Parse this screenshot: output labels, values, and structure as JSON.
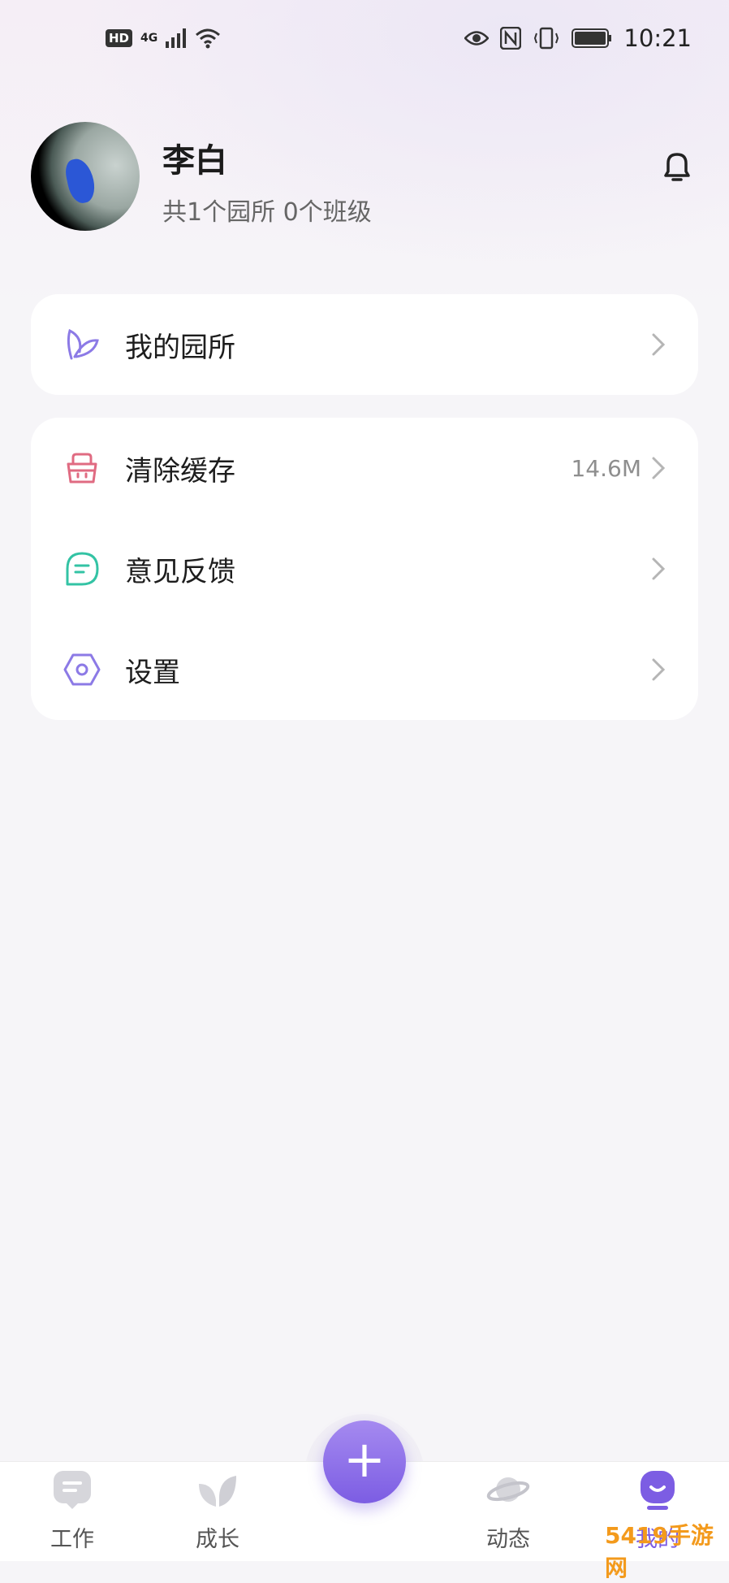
{
  "status_bar": {
    "hd": "HD",
    "signal": "4G",
    "time": "10:21"
  },
  "profile": {
    "name": "李白",
    "summary": "共1个园所 0个班级"
  },
  "menu": {
    "my_school": {
      "label": "我的园所"
    },
    "clear_cache": {
      "label": "清除缓存",
      "value": "14.6M"
    },
    "feedback": {
      "label": "意见反馈"
    },
    "settings": {
      "label": "设置"
    }
  },
  "tabs": [
    {
      "label": "工作",
      "icon": "work-icon"
    },
    {
      "label": "成长",
      "icon": "leaf-icon"
    },
    {
      "label": "动态",
      "icon": "planet-icon"
    },
    {
      "label": "我的",
      "icon": "profile-icon"
    }
  ],
  "fab": {
    "symbol": "+"
  },
  "colors": {
    "accent": "#7c5de3",
    "leaf": "#8c7ae6",
    "cache": "#e06b82",
    "feedback": "#33c3a4",
    "settings": "#8c7ae6"
  },
  "watermark": "5419手游网"
}
